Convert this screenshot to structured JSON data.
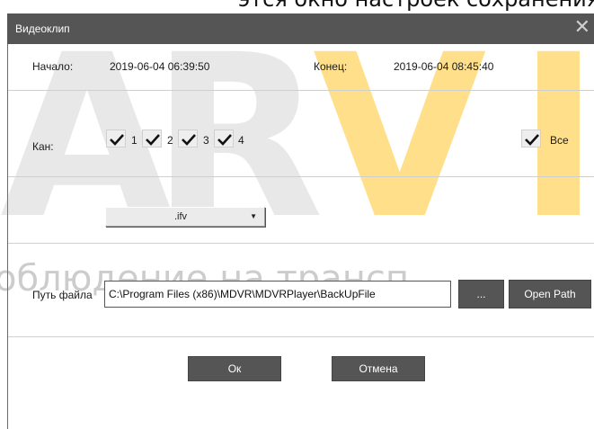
{
  "caption_fragment": "этся окно настроек сохранения файла.",
  "window": {
    "title": "Видеоклип",
    "close_glyph": "✕"
  },
  "watermark": {
    "letters": [
      "A",
      "R",
      "V",
      "I"
    ],
    "tagline": "облюдение на трансп"
  },
  "time": {
    "start_label": "Начало:",
    "start_value": "2019-06-04 06:39:50",
    "end_label": "Конец:",
    "end_value": "2019-06-04 08:45:40"
  },
  "channels": {
    "label": "Кан:",
    "items": [
      {
        "label": "1",
        "checked": true
      },
      {
        "label": "2",
        "checked": true
      },
      {
        "label": "3",
        "checked": true
      },
      {
        "label": "4",
        "checked": true
      }
    ],
    "all_label": "Все",
    "all_checked": true
  },
  "format": {
    "value": ".ifv"
  },
  "path": {
    "label": "Путь файла",
    "value": "C:\\Program Files (x86)\\MDVR\\MDVRPlayer\\BackUpFile",
    "browse_label": "...",
    "open_label": "Open Path"
  },
  "actions": {
    "ok_label": "Ок",
    "cancel_label": "Отмена"
  },
  "colors": {
    "titlebar": "#555555",
    "watermark_gray": "#969696",
    "watermark_yellow": "#ffc428"
  }
}
